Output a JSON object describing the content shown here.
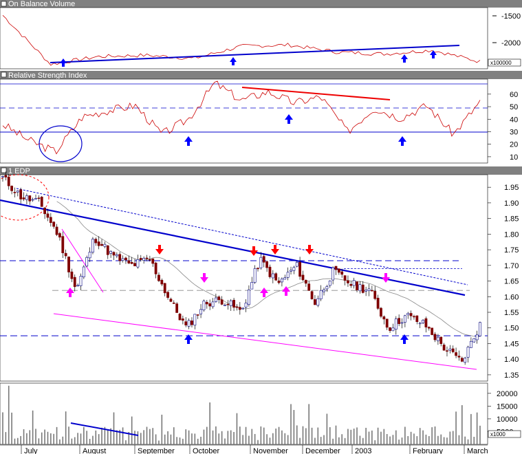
{
  "panels": {
    "obv": {
      "title": "On Balance Volume",
      "multiplier": "x100000",
      "ticks": [
        "-1500",
        "-2000"
      ]
    },
    "rsi": {
      "title": "Relative Strength Index",
      "ticks": [
        "60",
        "50",
        "40",
        "30",
        "20",
        "10"
      ]
    },
    "price": {
      "title": "1 EDP",
      "ticks": [
        "1.95",
        "1.90",
        "1.85",
        "1.80",
        "1.75",
        "1.70",
        "1.65",
        "1.60",
        "1.55",
        "1.50",
        "1.45",
        "1.40",
        "1.35"
      ]
    },
    "volume": {
      "multiplier": "x1000",
      "ticks": [
        "20000",
        "15000",
        "10000",
        "5000"
      ]
    }
  },
  "months": [
    "July",
    "August",
    "September",
    "October",
    "November",
    "December",
    "2003",
    "February",
    "March"
  ],
  "colors": {
    "background": "#ffffff",
    "title_bar": "#808080",
    "price_series": "#7f0000",
    "indicator_line": "#cc0000",
    "trendline": "#0000cc",
    "support_line": "#ff00ff",
    "arrow_up": "#0000ff",
    "arrow_down": "#ff0000",
    "arrow_magenta": "#ff00ff"
  },
  "chart_data": [
    {
      "type": "line",
      "title": "On Balance Volume",
      "unit_multiplier": "x100000",
      "x": [
        "Jul",
        "Aug",
        "Sep",
        "Oct",
        "Nov",
        "Dec",
        "2003",
        "Feb",
        "Mar"
      ],
      "ylim": [
        -2250,
        -1300
      ],
      "series": [
        {
          "values": [
            -1420,
            -2180,
            -2060,
            -2040,
            -2090,
            -1900,
            -1880,
            -1990,
            -2020,
            -1960,
            -2140
          ]
        }
      ],
      "annotations": [
        "rising trendline",
        "blue up arrows at trendline touches"
      ]
    },
    {
      "type": "line",
      "title": "Relative Strength Index",
      "ylim": [
        5,
        72
      ],
      "reference_lines": [
        50,
        30
      ],
      "series": [
        {
          "values": [
            36,
            23,
            14,
            42,
            47,
            51,
            28,
            40,
            69,
            55,
            62,
            53,
            58,
            30,
            49,
            41,
            51,
            28,
            54
          ]
        }
      ],
      "annotations": [
        "circle around oversold low",
        "declining red trendline over Nov-Dec highs",
        "blue up arrows at 30 level"
      ]
    },
    {
      "type": "line",
      "title": "1 EDP",
      "ylim": [
        1.33,
        1.99
      ],
      "series": [
        {
          "name": "EDP",
          "values": [
            1.98,
            1.92,
            1.9,
            1.8,
            1.62,
            1.79,
            1.73,
            1.7,
            1.72,
            1.6,
            1.5,
            1.58,
            1.59,
            1.55,
            1.72,
            1.64,
            1.7,
            1.58,
            1.68,
            1.64,
            1.62,
            1.5,
            1.54,
            1.51,
            1.44,
            1.39,
            1.51
          ]
        }
      ],
      "reference_lines": [
        1.715,
        1.69,
        1.62,
        1.475
      ],
      "annotations": [
        "descending blue resistance trendline",
        "descending magenta support line",
        "red down arrows at resistance",
        "blue up arrows at support",
        "magenta arrows"
      ]
    },
    {
      "type": "bar",
      "title": "",
      "unit_multiplier": "x1000",
      "ylim": [
        0,
        24000
      ],
      "annotations": [
        "declining blue trendline over volume in August"
      ]
    }
  ]
}
